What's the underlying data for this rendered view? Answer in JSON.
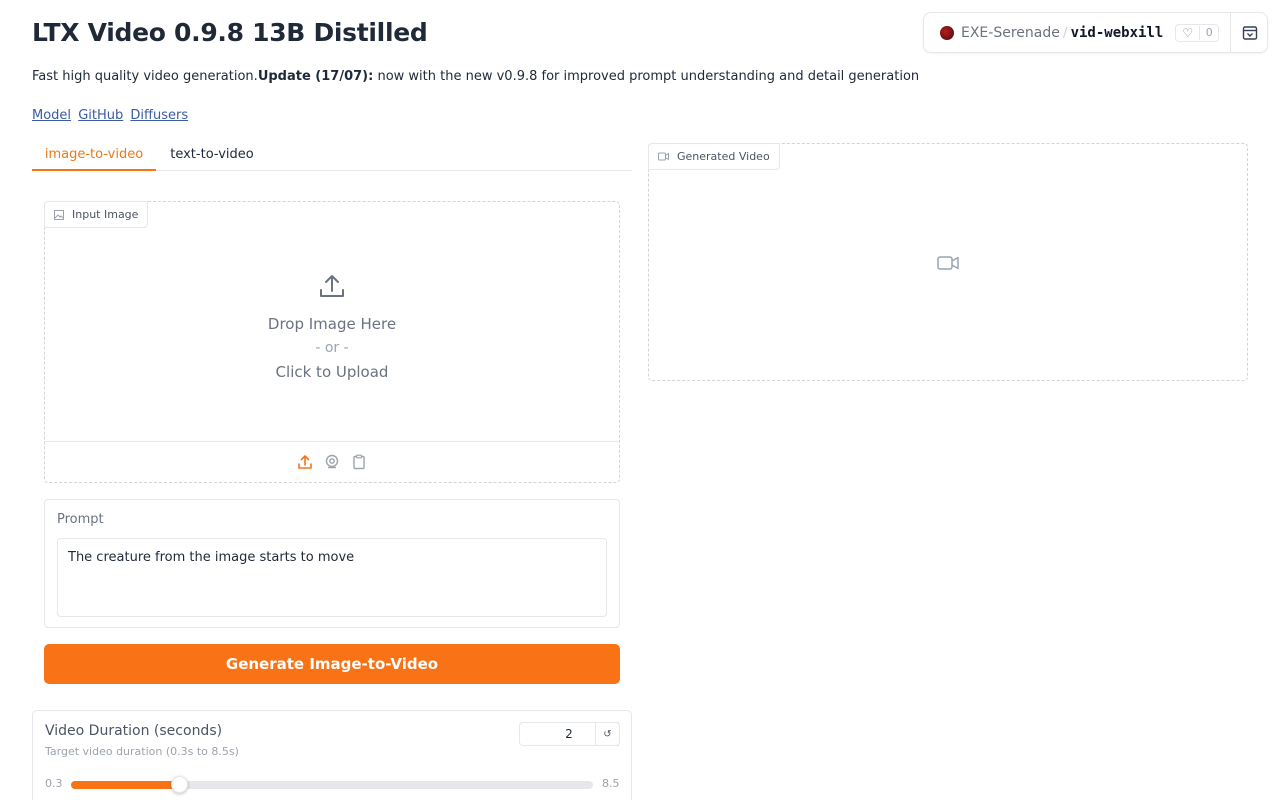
{
  "header": {
    "title": "LTX Video 0.9.8 13B Distilled",
    "description_plain": "Fast high quality video generation.",
    "description_bold": "Update (17/07):",
    "description_rest": " now with the new v0.9.8 for improved prompt understanding and detail generation",
    "links": [
      "Model",
      "GitHub",
      "Diffusers"
    ]
  },
  "space": {
    "owner": "EXE-Serenade",
    "separator": "/",
    "repo": "vid-webxill",
    "likes": "0"
  },
  "tabs": [
    {
      "label": "image-to-video",
      "active": true
    },
    {
      "label": "text-to-video",
      "active": false
    }
  ],
  "input_image": {
    "label": "Input Image",
    "drop_text": "Drop Image Here",
    "or_text": "- or -",
    "click_text": "Click to Upload"
  },
  "prompt": {
    "label": "Prompt",
    "value": "The creature from the image starts to move"
  },
  "generate_button": "Generate Image-to-Video",
  "duration": {
    "label": "Video Duration (seconds)",
    "info": "Target video duration (0.3s to 8.5s)",
    "value": "2",
    "min": "0.3",
    "max": "8.5",
    "reset_symbol": "↺"
  },
  "output": {
    "label": "Generated Video"
  },
  "colors": {
    "accent": "#f97316",
    "link": "#3b5ba5"
  },
  "icons": [
    "upload-icon",
    "webcam-icon",
    "clipboard-icon",
    "image-icon",
    "video-icon",
    "heart-icon",
    "collapse-icon"
  ]
}
